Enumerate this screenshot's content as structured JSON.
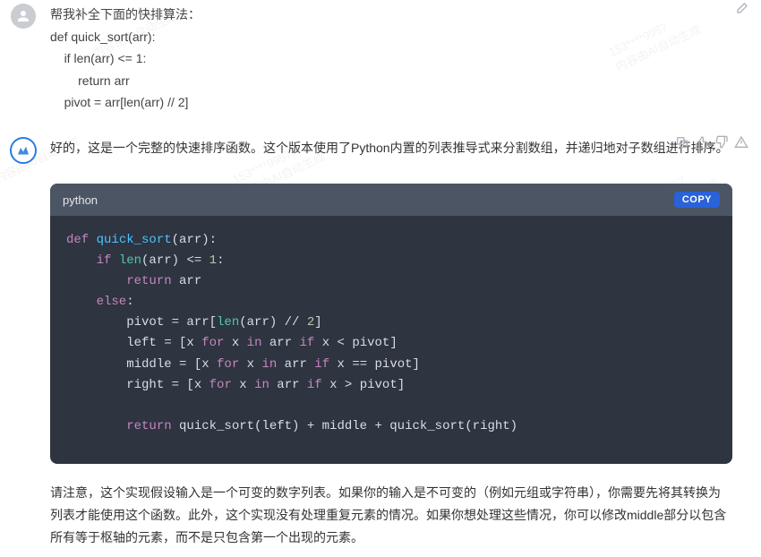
{
  "watermarks": {
    "id": "153****9957",
    "note": "内容由AI自动生成"
  },
  "user_message": {
    "line1": "帮我补全下面的快排算法：",
    "line2": "def quick_sort(arr):",
    "line3": "    if len(arr) <= 1:",
    "line4": "        return arr",
    "line5": "    pivot = arr[len(arr) // 2]"
  },
  "ai_message": {
    "intro": "好的，这是一个完整的快速排序函数。这个版本使用了Python内置的列表推导式来分割数组，并递归地对子数组进行排序。",
    "code": {
      "lang": "python",
      "copy_label": "COPY",
      "lines": {
        "l1_def": "def",
        "l1_fn": " quick_sort",
        "l1_rest": "(arr):",
        "l2_if": "    if",
        "l2_len": " len",
        "l2_rest1": "(arr) <= ",
        "l2_num": "1",
        "l2_rest2": ":",
        "l3_return": "        return",
        "l3_rest": " arr",
        "l4_else": "    else",
        "l4_rest": ":",
        "l5_pre": "        pivot = arr[",
        "l5_len": "len",
        "l5_mid": "(arr) // ",
        "l5_num": "2",
        "l5_end": "]",
        "l6_pre": "        left = [x ",
        "l6_for": "for",
        "l6_x": " x ",
        "l6_in": "in",
        "l6_arr": " arr ",
        "l6_if": "if",
        "l6_end": " x < pivot]",
        "l7_pre": "        middle = [x ",
        "l7_for": "for",
        "l7_x": " x ",
        "l7_in": "in",
        "l7_arr": " arr ",
        "l7_if": "if",
        "l7_end": " x == pivot]",
        "l8_pre": "        right = [x ",
        "l8_for": "for",
        "l8_x": " x ",
        "l8_in": "in",
        "l8_arr": " arr ",
        "l8_if": "if",
        "l8_end": " x > pivot]",
        "l9_blank": "",
        "l10_return": "        return",
        "l10_rest": " quick_sort(left) + middle + quick_sort(right)"
      }
    },
    "outro": "请注意，这个实现假设输入是一个可变的数字列表。如果你的输入是不可变的（例如元组或字符串），你需要先将其转换为列表才能使用这个函数。此外，这个实现没有处理重复元素的情况。如果你想处理这些情况，你可以修改middle部分以包含所有等于枢轴的元素，而不是只包含第一个出现的元素。"
  }
}
